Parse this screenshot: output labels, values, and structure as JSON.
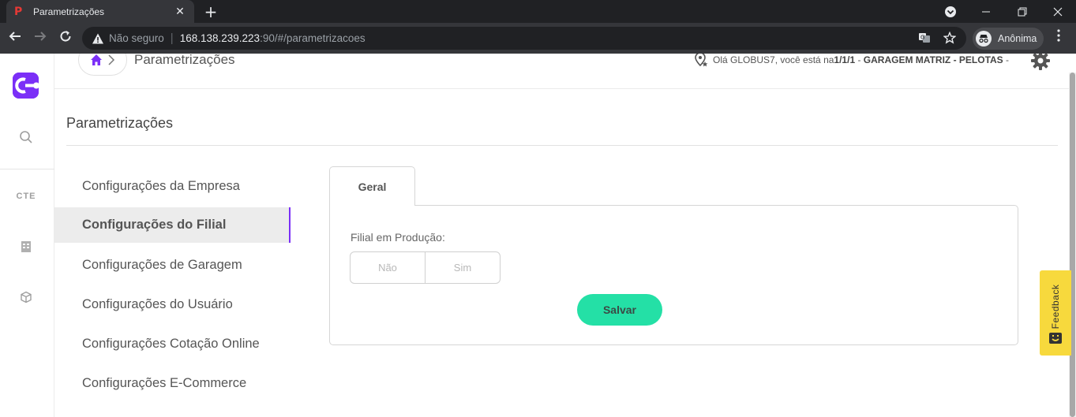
{
  "browser": {
    "tab_title": "Parametrizações",
    "tab_close": "✕",
    "new_tab": "+",
    "not_secure": "Não seguro",
    "url_host": "168.138.239.223",
    "url_rest": ":90/#/parametrizacoes",
    "profile_name": "Anônima"
  },
  "header": {
    "breadcrumb_title": "Parametrizações",
    "greeting_prefix": "Olá GLOBUS7, você está na ",
    "location_code": "1/1/1",
    "location_sep": " - ",
    "location_name": "GARAGEM MATRIZ - PELOTAS",
    "trailing": " -"
  },
  "sidebar": {
    "cte_label": "CTE"
  },
  "page": {
    "title": "Parametrizações"
  },
  "menu": {
    "items": [
      "Configurações da Empresa",
      "Configurações do Filial",
      "Configurações de Garagem",
      "Configurações do Usuário",
      "Configurações Cotação Online",
      "Configurações E-Commerce"
    ],
    "active_index": 1
  },
  "tabs": {
    "geral": "Geral"
  },
  "form": {
    "filial_label": "Filial em Produção:",
    "option_no": "Não",
    "option_yes": "Sim",
    "save_label": "Salvar"
  },
  "feedback": {
    "label": "Feedback"
  },
  "colors": {
    "accent": "#7b2ff7",
    "save": "#24e0a6",
    "feedback": "#f7d93d",
    "chrome_dark": "#202124"
  }
}
